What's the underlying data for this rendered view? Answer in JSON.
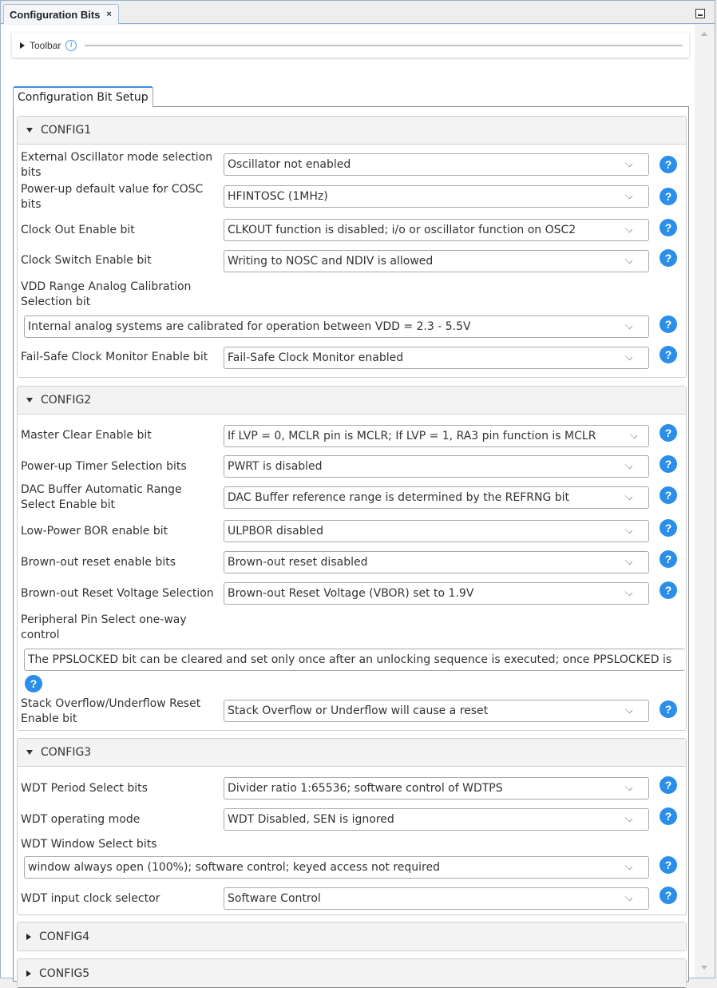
{
  "window": {
    "tab_title": "Configuration Bits",
    "tab_close": "×"
  },
  "toolbar": {
    "label": "Toolbar",
    "info_glyph": "i"
  },
  "setup_tab": "Configuration Bit Setup",
  "help_glyph": "?",
  "sections": [
    {
      "title": "CONFIG1",
      "expanded": true,
      "settings": [
        {
          "label": "External Oscillator mode selection bits",
          "value": "Oscillator not enabled"
        },
        {
          "label": "Power-up default value for COSC bits",
          "value": "HFINTOSC (1MHz)"
        },
        {
          "label": "Clock Out Enable bit",
          "value": "CLKOUT function is disabled; i/o or oscillator function on OSC2"
        },
        {
          "label": "Clock Switch Enable bit",
          "value": "Writing to NOSC and NDIV is allowed"
        },
        {
          "label": "VDD Range Analog Calibration Selection bit",
          "value": "Internal analog systems are calibrated for operation between VDD = 2.3 - 5.5V"
        },
        {
          "label": "Fail-Safe Clock Monitor Enable bit",
          "value": "Fail-Safe Clock Monitor enabled"
        }
      ]
    },
    {
      "title": "CONFIG2",
      "expanded": true,
      "settings": [
        {
          "label": "Master Clear Enable bit",
          "value": "If LVP = 0, MCLR pin is MCLR; If LVP = 1, RA3 pin function is MCLR"
        },
        {
          "label": "Power-up Timer Selection bits",
          "value": "PWRT is disabled"
        },
        {
          "label": "DAC Buffer Automatic Range Select Enable bit",
          "value": "DAC Buffer reference range is determined by the REFRNG bit"
        },
        {
          "label": "Low-Power BOR enable bit",
          "value": "ULPBOR disabled"
        },
        {
          "label": "Brown-out reset enable bits",
          "value": "Brown-out reset disabled"
        },
        {
          "label": "Brown-out Reset Voltage Selection",
          "value": "Brown-out Reset Voltage (VBOR) set to 1.9V"
        },
        {
          "label": "Peripheral Pin Select one-way control",
          "value": "The PPSLOCKED bit can be cleared and set only once after an unlocking sequence is executed; once PPSLOCKED is"
        },
        {
          "label": "Stack Overflow/Underflow Reset Enable bit",
          "value": "Stack Overflow or Underflow will cause a reset"
        }
      ]
    },
    {
      "title": "CONFIG3",
      "expanded": true,
      "settings": [
        {
          "label": "WDT Period Select bits",
          "value": "Divider ratio 1:65536; software control of WDTPS"
        },
        {
          "label": "WDT operating mode",
          "value": "WDT Disabled, SEN is ignored"
        },
        {
          "label": "WDT Window Select bits",
          "value": "window always open (100%); software control; keyed access not required"
        },
        {
          "label": "WDT input clock selector",
          "value": "Software Control"
        }
      ]
    },
    {
      "title": "CONFIG4",
      "expanded": false,
      "settings": []
    },
    {
      "title": "CONFIG5",
      "expanded": false,
      "settings": []
    }
  ]
}
